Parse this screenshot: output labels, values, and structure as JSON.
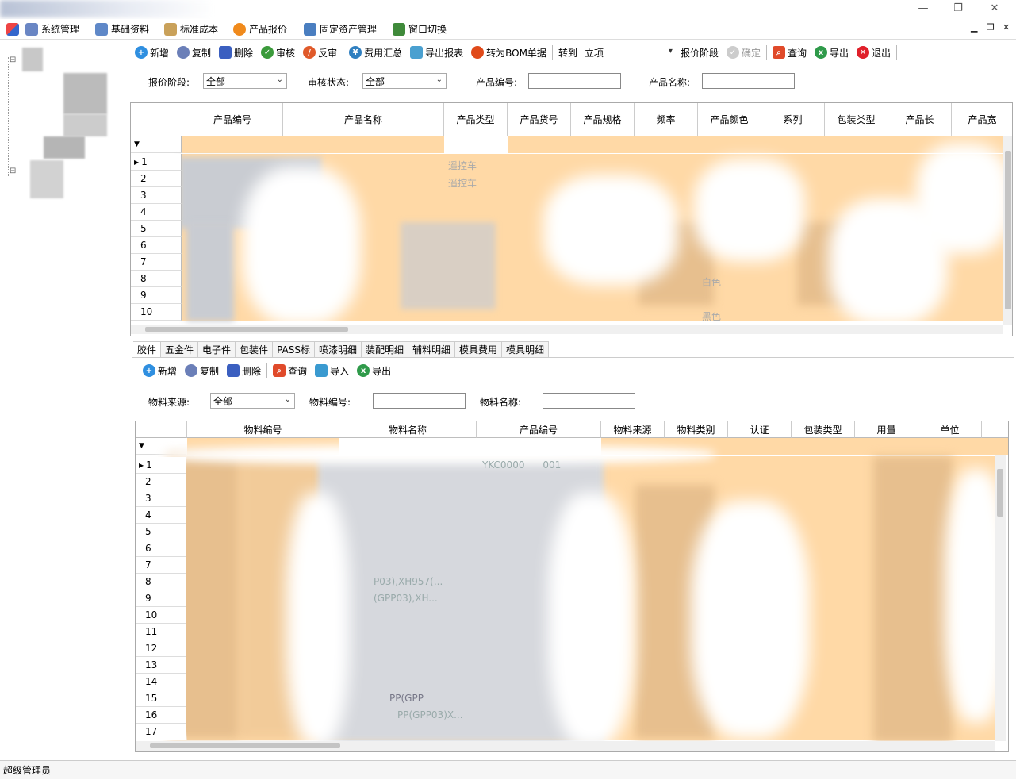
{
  "menubar": {
    "items": [
      {
        "label": "系统管理",
        "icon": "settings-icon",
        "color": "#6a86c4"
      },
      {
        "label": "基础资料",
        "icon": "database-icon",
        "color": "#5f88c8"
      },
      {
        "label": "标准成本",
        "icon": "folder-icon",
        "color": "#c9a15a"
      },
      {
        "label": "产品报价",
        "icon": "coin-icon",
        "color": "#f08a1c"
      },
      {
        "label": "固定资产管理",
        "icon": "chart-icon",
        "color": "#4a7ec0"
      },
      {
        "label": "窗口切换",
        "icon": "switch-window-icon",
        "color": "#3f8a3a"
      }
    ]
  },
  "toolbar_top": {
    "buttons": [
      {
        "label": "新增",
        "icon": "plus-icon",
        "color": "#2f8fe0"
      },
      {
        "label": "复制",
        "icon": "copy-icon",
        "color": "#6b7fb8"
      },
      {
        "label": "删除",
        "icon": "trash-icon",
        "color": "#3b5fc0"
      },
      {
        "label": "审核",
        "icon": "check-icon",
        "color": "#3b9a3b"
      },
      {
        "label": "反审",
        "icon": "unapprove-icon",
        "color": "#e05a2a"
      },
      {
        "label": "费用汇总",
        "icon": "yen-icon",
        "color": "#2f7fc0"
      },
      {
        "label": "导出报表",
        "icon": "export-report-icon",
        "color": "#4aa0d0"
      },
      {
        "label": "转为BOM单据",
        "icon": "bom-icon",
        "color": "#e04a1a"
      }
    ],
    "goto_label": "转到",
    "goto_value": "立项",
    "stage_label": "报价阶段",
    "confirm_label": "确定",
    "query_label": "查询",
    "export_label": "导出",
    "exit_label": "退出"
  },
  "filters_top": {
    "stage_label": "报价阶段:",
    "stage_value": "全部",
    "audit_label": "审核状态:",
    "audit_value": "全部",
    "code_label": "产品编号:",
    "name_label": "产品名称:"
  },
  "grid_top": {
    "columns": [
      "产品编号",
      "产品名称",
      "产品类型",
      "产品货号",
      "产品规格",
      "频率",
      "产品颜色",
      "系列",
      "包装类型",
      "产品长",
      "产品宽"
    ],
    "rows": [
      "1",
      "2",
      "3",
      "4",
      "5",
      "6",
      "7",
      "8",
      "9",
      "10"
    ],
    "fragments": {
      "r1_type": "遥控车",
      "r2_type": "遥控车",
      "r8_color": "白色",
      "r10_color": "黑色"
    }
  },
  "tabs": [
    "胶件",
    "五金件",
    "电子件",
    "包装件",
    "PASS标",
    "喷漆明细",
    "装配明细",
    "辅料明细",
    "模具费用",
    "模具明细"
  ],
  "toolbar_bottom": {
    "buttons": [
      {
        "label": "新增",
        "icon": "plus-icon",
        "color": "#2f8fe0"
      },
      {
        "label": "复制",
        "icon": "copy-icon",
        "color": "#6b7fb8"
      },
      {
        "label": "删除",
        "icon": "trash-icon",
        "color": "#3b5fc0"
      },
      {
        "label": "查询",
        "icon": "search-icon",
        "color": "#e04a2a"
      },
      {
        "label": "导入",
        "icon": "import-icon",
        "color": "#3a9ad0"
      },
      {
        "label": "导出",
        "icon": "excel-icon",
        "color": "#2f9a4a"
      }
    ]
  },
  "filters_bottom": {
    "source_label": "物料来源:",
    "source_value": "全部",
    "code_label": "物料编号:",
    "name_label": "物料名称:"
  },
  "grid_bottom": {
    "columns": [
      "物料编号",
      "物料名称",
      "产品编号",
      "物料来源",
      "物料类别",
      "认证",
      "包装类型",
      "用量",
      "单位"
    ],
    "rows": [
      "1",
      "2",
      "3",
      "4",
      "5",
      "6",
      "7",
      "8",
      "9",
      "10",
      "11",
      "12",
      "13",
      "14",
      "15",
      "16",
      "17"
    ],
    "fragments": {
      "r1_code": "YKC0000",
      "r1_code2": "001",
      "r8_name": "P03),XH957(...",
      "r9_name": "(GPP03),XH...",
      "r15_name": "PP(GPP",
      "r16_name": "PP(GPP03)X..."
    }
  },
  "statusbar": {
    "user": "超级管理员"
  }
}
